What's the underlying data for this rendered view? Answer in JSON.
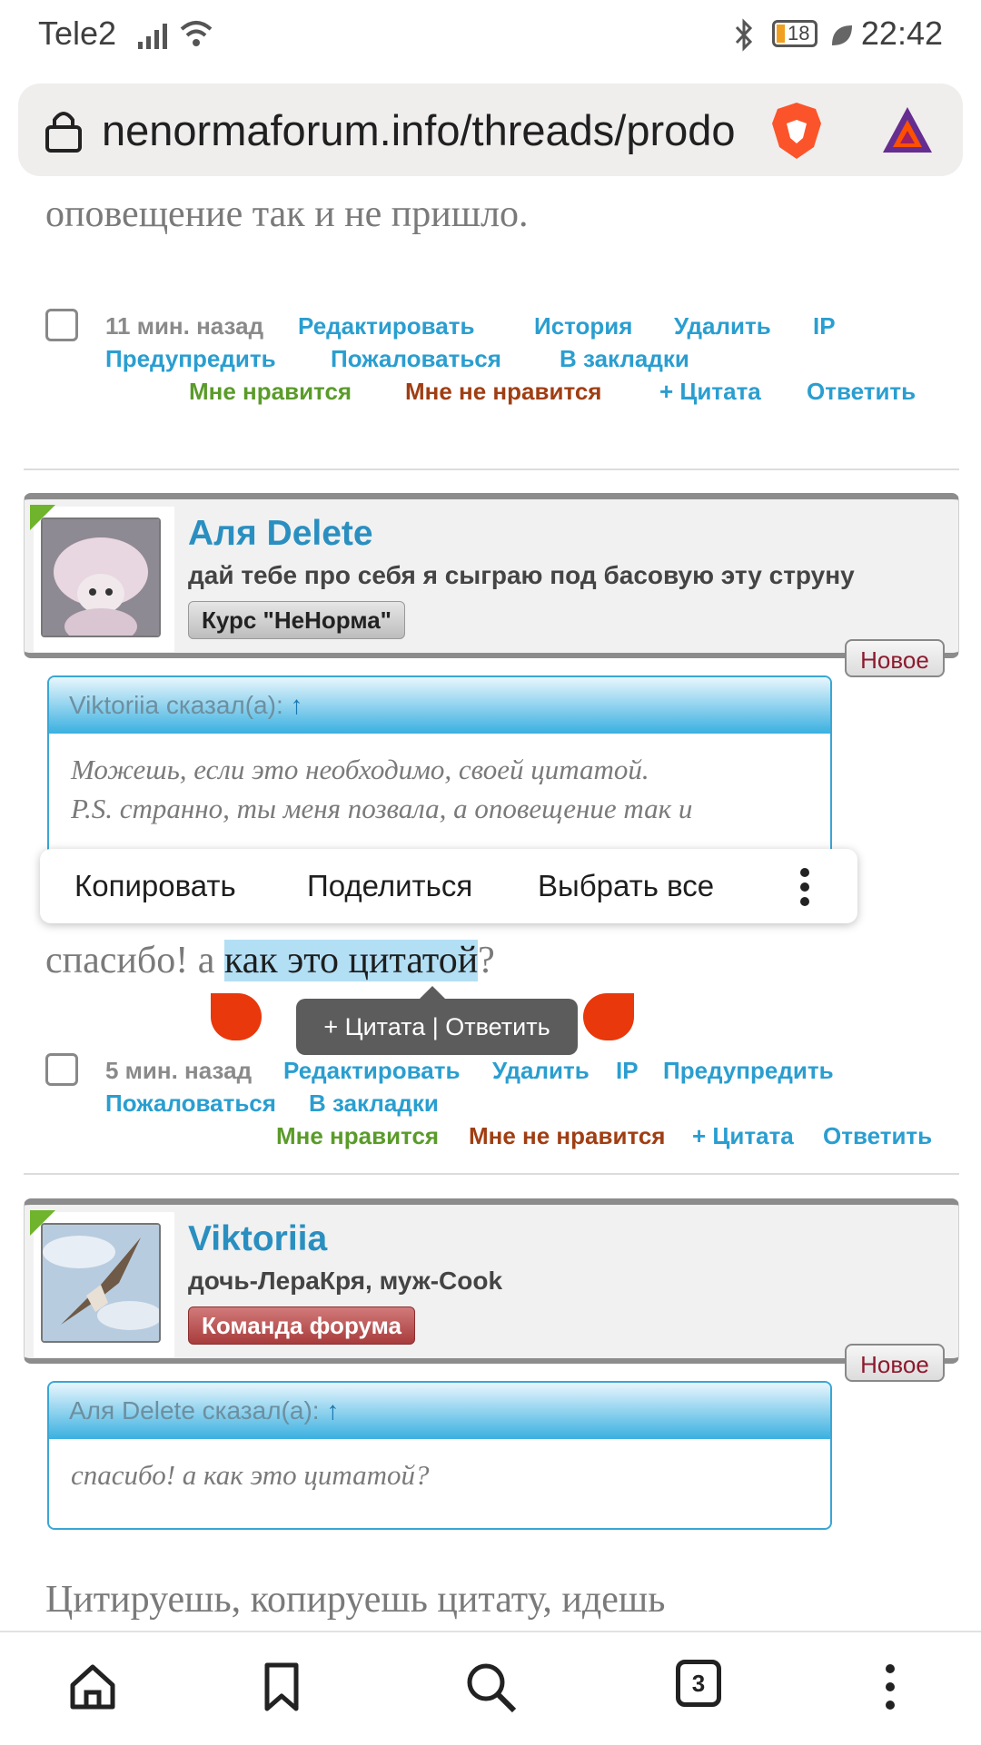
{
  "status_bar": {
    "carrier": "Tele2",
    "battery": "18",
    "time": "22:42"
  },
  "browser": {
    "url": "nenormaforum.info/threads/prodo",
    "tab_count": "3"
  },
  "post1": {
    "tail_text": "оповещение так и не пришло.",
    "time": "11 мин. назад",
    "actions_row1": [
      "Редактировать",
      "История",
      "Удалить",
      "IP"
    ],
    "actions_row2": [
      "Предупредить",
      "Пожаловаться",
      "В закладки"
    ],
    "like": "Мне нравится",
    "dislike": "Мне не нравится",
    "quote_add": "+ Цитата",
    "reply": "Ответить"
  },
  "post2": {
    "username": "Аля Delete",
    "user_title": "дай тебе про себя я сыграю под басовую эту струну",
    "rank": "Курс \"НеНорма\"",
    "badge": "Новое",
    "quote_author": "Viktoriia сказал(а):",
    "quote_arrow": "↑",
    "quote_line1": "Можешь, если это необходимо, своей цитатой.",
    "quote_line2": "P.S. странно, ты меня позвала, а оповещение так и",
    "text_before": "спасибо! а ",
    "text_selected": "как это цитатой",
    "text_after": "?",
    "time": "5 мин. назад",
    "actions_row1": [
      "Редактировать",
      "Удалить",
      "IP",
      "Предупредить"
    ],
    "actions_row2": [
      "Пожаловаться",
      "В закладки"
    ],
    "like": "Мне нравится",
    "dislike": "Мне не нравится",
    "quote_add": "+ Цитата",
    "reply": "Ответить"
  },
  "context_menu": {
    "copy": "Копировать",
    "share": "Поделиться",
    "select_all": "Выбрать все"
  },
  "selection_tooltip": "+ Цитата | Ответить",
  "post3": {
    "username": "Viktoriia",
    "user_title": "дочь-ЛераКря, муж-Cook",
    "rank": "Команда форума",
    "badge": "Новое",
    "quote_author": "Аля Delete сказал(а):",
    "quote_arrow": "↑",
    "quote_text": "спасибо! а как это цитатой?",
    "text": "Цитируешь, копируешь цитату, идешь"
  },
  "colors": {
    "link": "#2a9ed0",
    "like": "#5a9b2a",
    "dislike": "#a03e13",
    "username": "#2a8fc0"
  },
  "nav": [
    "home-icon",
    "bookmark-icon",
    "search-icon",
    "tabs-icon",
    "more-icon"
  ]
}
